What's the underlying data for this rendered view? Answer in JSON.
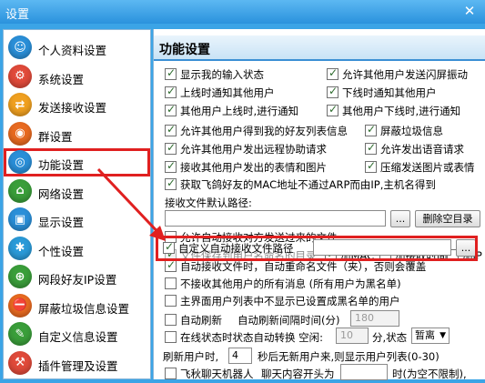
{
  "window": {
    "title": "设置",
    "close": "✕"
  },
  "sidebar": {
    "items": [
      {
        "label": "个人资料设置",
        "icon": "personal-info-icon",
        "color": "#2a8fd8"
      },
      {
        "label": "系统设置",
        "icon": "system-settings-icon",
        "color": "#e04a3a"
      },
      {
        "label": "发送接收设置",
        "icon": "send-receive-icon",
        "color": "#f0a020"
      },
      {
        "label": "群设置",
        "icon": "group-settings-icon",
        "color": "#e86a20"
      },
      {
        "label": "功能设置",
        "icon": "function-settings-icon",
        "color": "#2a8fd8"
      },
      {
        "label": "网络设置",
        "icon": "network-settings-icon",
        "color": "#3a9e3a"
      },
      {
        "label": "显示设置",
        "icon": "display-settings-icon",
        "color": "#2a8fd8"
      },
      {
        "label": "个性设置",
        "icon": "personalize-icon",
        "color": "#2a9ad8"
      },
      {
        "label": "网段好友IP设置",
        "icon": "ip-segment-icon",
        "color": "#3a9e3a"
      },
      {
        "label": "屏蔽垃圾信息设置",
        "icon": "spam-block-icon",
        "color": "#e86a20"
      },
      {
        "label": "自定义信息设置",
        "icon": "custom-info-icon",
        "color": "#3a9e3a"
      },
      {
        "label": "插件管理及设置",
        "icon": "plugin-icon",
        "color": "#e04a3a"
      }
    ]
  },
  "main": {
    "title": "功能设置",
    "opt_show_input_status": "显示我的输入状态",
    "opt_allow_flash": "允许其他用户发送闪屏振动",
    "opt_online_notify": "上线时通知其他用户",
    "opt_offline_notify": "下线时通知其他用户",
    "opt_user_online_notify": "其他用户上线时,进行通知",
    "opt_user_offline_notify": "其他用户下线时,进行通知",
    "opt_allow_friend_list": "允许其他用户得到我的好友列表信息",
    "opt_block_spam": "屏蔽垃圾信息",
    "opt_allow_remote_assist": "允许其他用户发出远程协助请求",
    "opt_allow_voice": "允许发出语音请求",
    "opt_receive_emoticons": "接收其他用户发出的表情和图片",
    "opt_compress_images": "压缩发送图片或表情",
    "opt_get_mac": "获取飞鸽好友的MAC地址不通过ARP而由IP,主机名得到",
    "recv_folder_label": "接收文件默认路径:",
    "browse": "...",
    "delete_empty_dirs": "删除空目录",
    "opt_auto_recv_folder": "允许自动接收对方发送过来的文件",
    "opt_save_user_folder": "文件保存到用户名命名的目录",
    "opt_add_mac": "加MAC",
    "opt_add_recv_time": "加接收时间",
    "opt_add_ip": "加IP",
    "opt_custom_recv_path": "自定义自动接收文件路径",
    "opt_auto_recv_rename": "自动接收文件时，自动重命名文件（夹），否则会覆盖",
    "opt_no_other_msgs": "不接收其他用户的所有消息 (所有用户为黑名单)",
    "opt_main_list_blacklist": "主界面用户列表中不显示已设置成黑名单的用户",
    "opt_auto_refresh": "自动刷新",
    "auto_refresh_interval_label": "自动刷新间隔时间(分)",
    "auto_refresh_interval_value": "180",
    "opt_idle_status": "在线状态时状态自动转换 空闲:",
    "idle_minutes": "10",
    "idle_unit": "分,状态",
    "idle_status_value": "暂离",
    "refresh_time_label": "刷新用户时,",
    "refresh_time_value": "4",
    "refresh_time_desc": "秒后无新用户来,则显示用户列表(0-30)",
    "opt_feiqiu_robot": "飞秋聊天机器人",
    "chat_prefix_label": "聊天内容开头为",
    "chat_prefix_desc": "时(为空不限制),"
  }
}
